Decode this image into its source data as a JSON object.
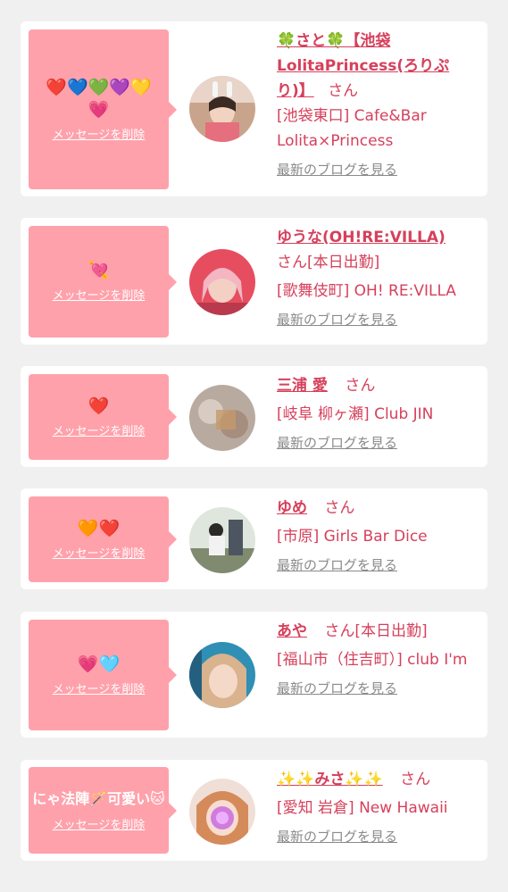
{
  "colors": {
    "bubble": "#ffa1ab",
    "name_pink": "#d6405b",
    "link_gray": "#8a8a8a",
    "page_bg": "#f0f0f0"
  },
  "delete_label": "メッセージを削除",
  "blog_label": "最新のブログを見る",
  "cards": [
    {
      "message": "❤️💙💚💜💛💗",
      "name": "🍀さと🍀【池袋LolitaPrincess(ろりぷり)】",
      "san": "さん",
      "shop": "[池袋東口] Cafe&Bar Lolita×Princess"
    },
    {
      "message": "💘",
      "name": "ゆうな(OH!RE:VILLA)",
      "san": "さん[本日出勤]",
      "shop": "[歌舞伎町] OH! RE:VILLA"
    },
    {
      "message": "❤️",
      "name": "三浦 愛",
      "san": "さん",
      "shop": "[岐阜 柳ヶ瀬] Club JIN"
    },
    {
      "message": "🧡❤️",
      "name": "ゆめ",
      "san": "さん",
      "shop": "[市原] Girls Bar Dice"
    },
    {
      "message": "💗🩵",
      "name": "あや",
      "san": "さん[本日出勤]",
      "shop": "[福山市（住吉町）] club I'm"
    },
    {
      "message": "にゃ法陣🪄可愛い🐱",
      "name": "✨✨みさ✨✨",
      "san": "さん",
      "shop": "[愛知 岩倉] New Hawaii"
    }
  ]
}
